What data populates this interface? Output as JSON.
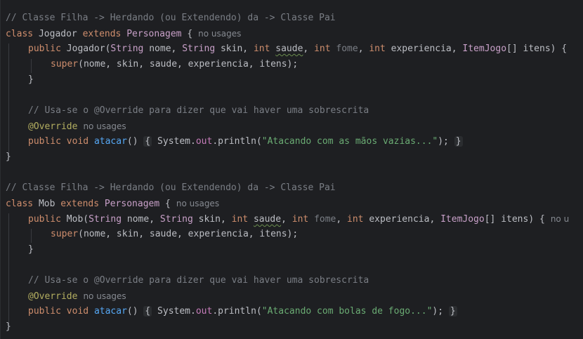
{
  "lines": {
    "l1": {
      "comment": "// Classe Filha -> Herdando (ou Extendendo) da -> Classe Pai"
    },
    "l2": {
      "kw1": "class",
      "name": "Jogador",
      "kw2": "extends",
      "parent": "Personagem",
      "brace": "{",
      "usage": "no usages"
    },
    "l3": {
      "mod": "public",
      "ctor": "Jogador",
      "open": "(",
      "t1": "String",
      "p1": "nome",
      "t2": "String",
      "p2": "skin",
      "t3": "int",
      "p3": "saude",
      "t4": "int",
      "p4": "fome",
      "t5": "int",
      "p5": "experiencia",
      "t6": "ItemJogo",
      "p6": "[] itens) {"
    },
    "l4": {
      "call": "super",
      "args": "(nome, skin, saude, experiencia, itens);"
    },
    "l5": {
      "text": "}"
    },
    "l7": {
      "comment": "// Usa-se o @Override para dizer que vai haver uma sobrescrita"
    },
    "l8": {
      "ann": "@Override",
      "usage": "no usages"
    },
    "l9": {
      "mod": "public",
      "kw": "void",
      "fn": "atacar",
      "paren": "()",
      "open": "{",
      "sys": "System.",
      "out": "out",
      "print": ".println(",
      "str": "\"Atacando com as mãos vazias...\"",
      "end": ");",
      "close": "}"
    },
    "l10": {
      "text": "}"
    },
    "l12": {
      "comment": "// Classe Filha -> Herdando (ou Extendendo) da -> Classe Pai"
    },
    "l13": {
      "kw1": "class",
      "name": "Mob",
      "kw2": "extends",
      "parent": "Personagem",
      "brace": "{",
      "usage": "no usages"
    },
    "l14": {
      "mod": "public",
      "ctor": "Mob",
      "open": "(",
      "t1": "String",
      "p1": "nome",
      "t2": "String",
      "p2": "skin",
      "t3": "int",
      "p3": "saude",
      "t4": "int",
      "p4": "fome",
      "t5": "int",
      "p5": "experiencia",
      "t6": "ItemJogo",
      "p6": "[] itens) {",
      "usage": "no u"
    },
    "l15": {
      "call": "super",
      "args": "(nome, skin, saude, experiencia, itens);"
    },
    "l16": {
      "text": "}"
    },
    "l18": {
      "comment": "// Usa-se o @Override para dizer que vai haver uma sobrescrita"
    },
    "l19": {
      "ann": "@Override",
      "usage": "no usages"
    },
    "l20": {
      "mod": "public",
      "kw": "void",
      "fn": "atacar",
      "paren": "()",
      "open": "{",
      "sys": "System.",
      "out": "out",
      "print": ".println(",
      "str": "\"Atacando com bolas de fogo...\"",
      "end": ");",
      "close": "}"
    },
    "l21": {
      "text": "}"
    }
  }
}
